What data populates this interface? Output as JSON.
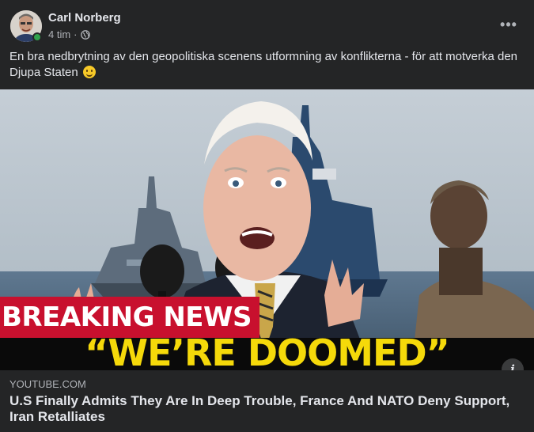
{
  "post": {
    "author": "Carl Norberg",
    "time": "4 tim",
    "separator": "·",
    "privacy_icon": "globe-icon",
    "more_icon": "more-horizontal-icon",
    "more_label": "•••",
    "text": "En bra nedbrytning av den geopolitiska scenens utformning av konflikterna - för att motverka den Djupa Staten",
    "emoji": "slightly-smiling-face"
  },
  "link": {
    "thumbnail_banner": "BREAKING NEWS",
    "thumbnail_headline": "“WE’RE DOOMED”",
    "info_icon": "info-icon",
    "info_label": "i",
    "domain": "YOUTUBE.COM",
    "title": "U.S Finally Admits They Are In Deep Trouble, France And NATO Deny Support, Iran Retalliates"
  },
  "colors": {
    "background": "#242526",
    "primary_text": "#e4e6eb",
    "secondary_text": "#b0b3b8",
    "online": "#31a24c",
    "banner_red": "#c8102e",
    "headline_yellow": "#f5d90a"
  }
}
